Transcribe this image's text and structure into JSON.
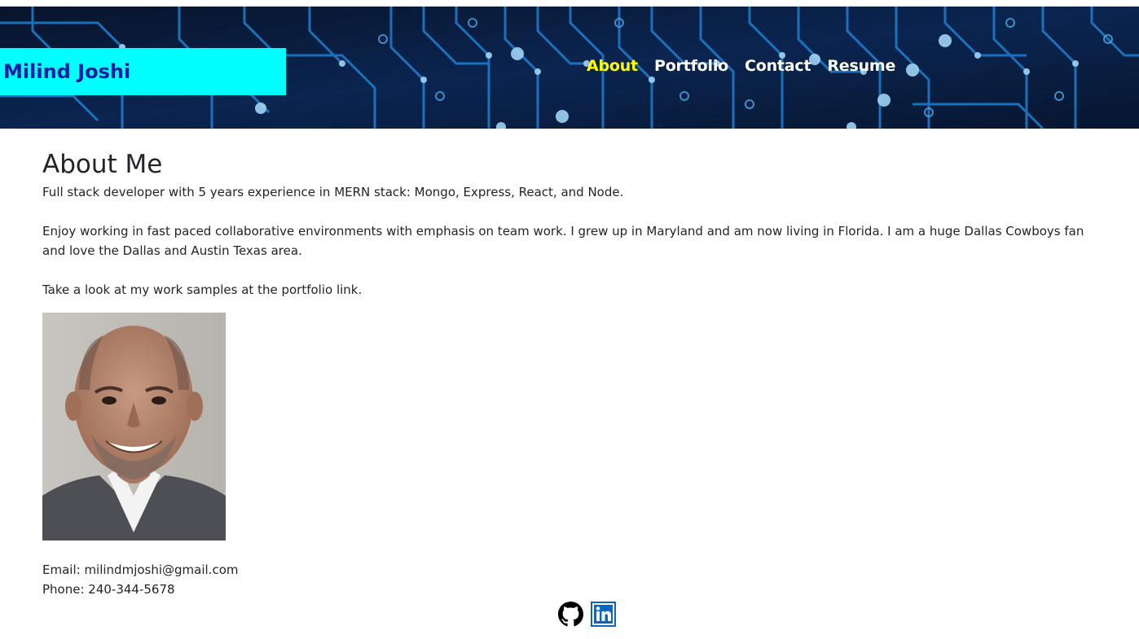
{
  "header": {
    "brand": "Milind Joshi",
    "nav": {
      "about": "About",
      "portfolio": "Portfolio",
      "contact": "Contact",
      "resume": "Resume"
    },
    "active_color": "#ffff00",
    "brand_bg": "#00ffff",
    "brand_color": "#0b1aa8"
  },
  "main": {
    "title": "About Me",
    "intro": "Full stack developer with 5 years experience in MERN stack: Mongo, Express, React, and Node.",
    "bio": "Enjoy working in fast paced collaborative environments with emphasis on team work. I grew up in Maryland and am now living in Florida. I am a huge Dallas Cowboys fan and love the Dallas and Austin Texas area.",
    "cta": "Take a look at my work samples at the portfolio link.",
    "photo_icon": "profile-photo",
    "email": "Email: milindmjoshi@gmail.com",
    "phone": "Phone: 240-344-5678"
  },
  "footer": {
    "icons": [
      "github-icon",
      "linkedin-icon"
    ],
    "linkedin_color": "#0a66c2"
  }
}
